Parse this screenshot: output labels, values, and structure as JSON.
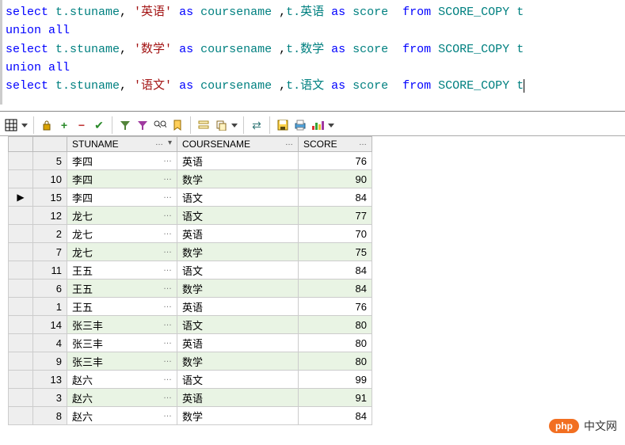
{
  "sql_tokens": [
    [
      {
        "t": "select ",
        "c": "kw"
      },
      {
        "t": "t.stuname",
        "c": "col"
      },
      {
        "t": ", ",
        "c": ""
      },
      {
        "t": "'英语'",
        "c": "str"
      },
      {
        "t": " as ",
        "c": "kw"
      },
      {
        "t": "coursename",
        "c": "col"
      },
      {
        "t": " ,",
        "c": ""
      },
      {
        "t": "t.英语",
        "c": "col"
      },
      {
        "t": " as ",
        "c": "kw"
      },
      {
        "t": "score",
        "c": "col"
      },
      {
        "t": "  from ",
        "c": "kw"
      },
      {
        "t": "SCORE_COPY t",
        "c": "col"
      }
    ],
    [
      {
        "t": "union all",
        "c": "kw"
      }
    ],
    [
      {
        "t": "select ",
        "c": "kw"
      },
      {
        "t": "t.stuname",
        "c": "col"
      },
      {
        "t": ", ",
        "c": ""
      },
      {
        "t": "'数学'",
        "c": "str"
      },
      {
        "t": " as ",
        "c": "kw"
      },
      {
        "t": "coursename",
        "c": "col"
      },
      {
        "t": " ,",
        "c": ""
      },
      {
        "t": "t.数学",
        "c": "col"
      },
      {
        "t": " as ",
        "c": "kw"
      },
      {
        "t": "score",
        "c": "col"
      },
      {
        "t": "  from ",
        "c": "kw"
      },
      {
        "t": "SCORE_COPY t",
        "c": "col"
      }
    ],
    [
      {
        "t": "union all",
        "c": "kw"
      }
    ],
    [
      {
        "t": "select ",
        "c": "kw"
      },
      {
        "t": "t.stuname",
        "c": "col"
      },
      {
        "t": ", ",
        "c": ""
      },
      {
        "t": "'语文'",
        "c": "str"
      },
      {
        "t": " as ",
        "c": "kw"
      },
      {
        "t": "coursename",
        "c": "col"
      },
      {
        "t": " ,",
        "c": ""
      },
      {
        "t": "t.语文",
        "c": "col"
      },
      {
        "t": " as ",
        "c": "kw"
      },
      {
        "t": "score",
        "c": "col"
      },
      {
        "t": "  from ",
        "c": "kw"
      },
      {
        "t": "SCORE_COPY t",
        "c": "col"
      }
    ]
  ],
  "columns": {
    "stuname": "STUNAME",
    "coursename": "COURSENAME",
    "score": "SCORE"
  },
  "current_row_index": 15,
  "rows": [
    {
      "n": 5,
      "stuname": "李四",
      "course": "英语",
      "score": 76
    },
    {
      "n": 10,
      "stuname": "李四",
      "course": "数学",
      "score": 90
    },
    {
      "n": 15,
      "stuname": "李四",
      "course": "语文",
      "score": 84
    },
    {
      "n": 12,
      "stuname": "龙七",
      "course": "语文",
      "score": 77
    },
    {
      "n": 2,
      "stuname": "龙七",
      "course": "英语",
      "score": 70
    },
    {
      "n": 7,
      "stuname": "龙七",
      "course": "数学",
      "score": 75
    },
    {
      "n": 11,
      "stuname": "王五",
      "course": "语文",
      "score": 84
    },
    {
      "n": 6,
      "stuname": "王五",
      "course": "数学",
      "score": 84
    },
    {
      "n": 1,
      "stuname": "王五",
      "course": "英语",
      "score": 76
    },
    {
      "n": 14,
      "stuname": "张三丰",
      "course": "语文",
      "score": 80
    },
    {
      "n": 4,
      "stuname": "张三丰",
      "course": "英语",
      "score": 80
    },
    {
      "n": 9,
      "stuname": "张三丰",
      "course": "数学",
      "score": 80
    },
    {
      "n": 13,
      "stuname": "赵六",
      "course": "语文",
      "score": 99
    },
    {
      "n": 3,
      "stuname": "赵六",
      "course": "英语",
      "score": 91
    },
    {
      "n": 8,
      "stuname": "赵六",
      "course": "数学",
      "score": 84
    }
  ],
  "cell_dots": "…",
  "header_arrow": "▾",
  "header_dots": "…",
  "row_marker": "▶",
  "watermark": {
    "logo": "php",
    "text": "中文网"
  }
}
